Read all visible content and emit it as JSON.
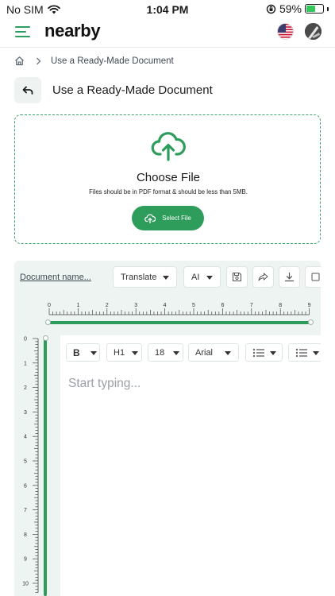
{
  "status_bar": {
    "carrier": "No SIM",
    "time": "1:04 PM",
    "battery": "59%",
    "battery_level": 0.59
  },
  "header": {
    "brand": "nearby"
  },
  "breadcrumb": {
    "current": "Use a Ready-Made Document"
  },
  "page": {
    "title": "Use a Ready-Made Document"
  },
  "upload": {
    "title": "Choose File",
    "note": "Files should be in PDF format & should be less than 5MB.",
    "button_label": "Select File"
  },
  "editor": {
    "doc_name": "Document name...",
    "translate_label": "Translate",
    "ai_label": "AI",
    "format": {
      "bold": "B",
      "heading": "H1",
      "size": "18",
      "font": "Arial"
    },
    "placeholder": "Start typing...",
    "h_ruler_labels": [
      "0",
      "1",
      "2",
      "3",
      "4",
      "5",
      "6",
      "7",
      "8",
      "9"
    ],
    "v_ruler_labels": [
      "0",
      "1",
      "2",
      "3",
      "4",
      "5",
      "6",
      "7",
      "8",
      "9",
      "10"
    ]
  },
  "colors": {
    "accent": "#2e9c5a",
    "panel_bg": "#eef4f1"
  }
}
